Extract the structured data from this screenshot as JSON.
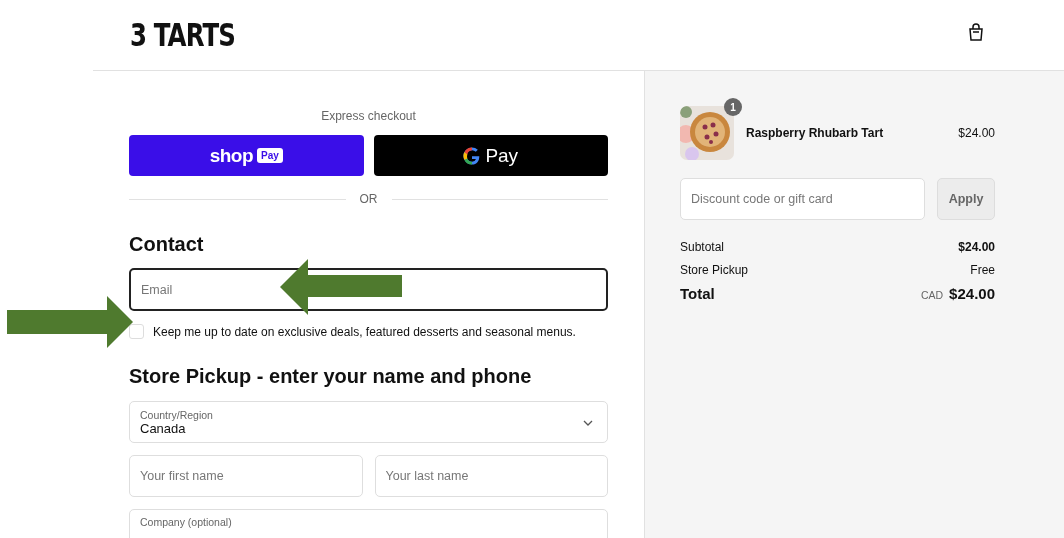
{
  "header": {
    "logo": "3 TARTS"
  },
  "express_checkout": {
    "label": "Express checkout",
    "buttons": [
      {
        "kind": "shop",
        "brand": "shop",
        "badge": "Pay"
      },
      {
        "kind": "gpay",
        "brand": "Pay"
      }
    ],
    "divider": "OR"
  },
  "contact": {
    "heading": "Contact",
    "email": {
      "placeholder": "Email"
    },
    "newsletter": {
      "label": "Keep me up to date on exclusive deals, featured desserts and seasonal menus.",
      "checked": false
    }
  },
  "pickup": {
    "heading": "Store Pickup - enter your name and phone",
    "country": {
      "label": "Country/Region",
      "value": "Canada"
    },
    "first_name": {
      "placeholder": "Your first name"
    },
    "last_name": {
      "placeholder": "Your last name"
    },
    "company": {
      "label": "Company (optional)"
    }
  },
  "summary": {
    "items": [
      {
        "name": "Raspberry Rhubarb Tart",
        "price": "$24.00",
        "quantity": "1",
        "kind": "picture"
      }
    ],
    "discount": {
      "placeholder": "Discount code or gift card",
      "button": "Apply"
    },
    "lines": [
      {
        "label": "Subtotal",
        "value": "$24.00",
        "kind": "bold-value"
      },
      {
        "label": "Store Pickup",
        "value": "Free",
        "kind": "plain"
      }
    ],
    "total": {
      "label": "Total",
      "currency": "CAD",
      "value": "$24.00"
    }
  }
}
